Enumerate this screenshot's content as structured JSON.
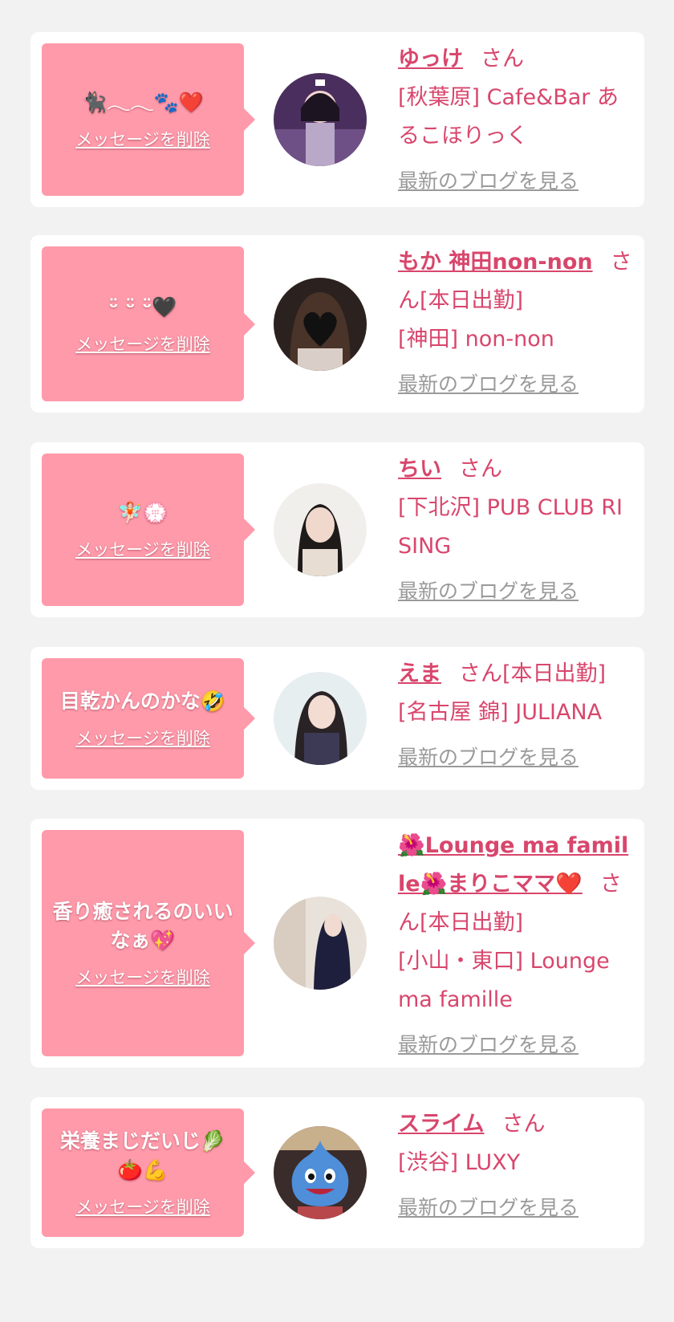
{
  "delete_label": "メッセージを削除",
  "blog_label": "最新のブログを見る",
  "san_label": "さん",
  "colors": {
    "bubble": "#ff9aaa",
    "accent": "#d8466c",
    "link_gray": "#9a9a9a",
    "page_bg": "#f2f2f2"
  },
  "cards": [
    {
      "message": "🐈‍⬛𓂃𓂃🐾❤️",
      "name": "ゆっけ",
      "suffix": "",
      "shop": "[秋葉原] Cafe&Bar あるこほりっく"
    },
    {
      "message": "ᵕ̈ ᵕ̈ ᵕ̈🖤",
      "name": "もか 神田non-non",
      "suffix": "[本日出勤]",
      "shop": "[神田] non-non"
    },
    {
      "message": "🧚🏻💮",
      "name": "ちい",
      "suffix": "",
      "shop": "[下北沢] PUB CLUB RISING"
    },
    {
      "message": "目乾かんのかな🤣",
      "name": "えま",
      "suffix": "[本日出勤]",
      "shop": "[名古屋 錦] JULIANA"
    },
    {
      "message": "香り癒されるのいいなぁ💖",
      "name": "🌺Lounge ma famille🌺まりこママ❤️",
      "suffix": "[本日出勤]",
      "shop": "[小山・東口] Lounge ma famille"
    },
    {
      "message": "栄養まじだいじ🥬🍅💪",
      "name": "スライム",
      "suffix": "",
      "shop": "[渋谷] LUXY"
    }
  ]
}
